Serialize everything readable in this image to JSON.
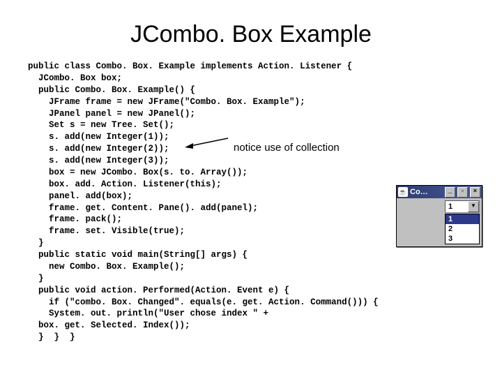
{
  "title": "JCombo. Box Example",
  "code_lines": [
    "public class Combo. Box. Example implements Action. Listener {",
    "  JCombo. Box box;",
    "  public Combo. Box. Example() {",
    "    JFrame frame = new JFrame(\"Combo. Box. Example\");",
    "    JPanel panel = new JPanel();",
    "    Set s = new Tree. Set();",
    "    s. add(new Integer(1));",
    "    s. add(new Integer(2));",
    "    s. add(new Integer(3));",
    "    box = new JCombo. Box(s. to. Array());",
    "    box. add. Action. Listener(this);",
    "    panel. add(box);",
    "    frame. get. Content. Pane(). add(panel);",
    "    frame. pack();",
    "    frame. set. Visible(true);",
    "  }",
    "  public static void main(String[] args) {",
    "    new Combo. Box. Example();",
    "  }",
    "  public void action. Performed(Action. Event e) {",
    "    if (\"combo. Box. Changed\". equals(e. get. Action. Command())) {",
    "    System. out. println(\"User chose index \" +",
    "  box. get. Selected. Index());",
    "  }  }  }"
  ],
  "annotation": "notice use of collection",
  "window": {
    "title": "Co…",
    "buttons": {
      "min": "_",
      "max": "▫",
      "close": "×"
    },
    "selected": "1",
    "drop_glyph": "▼",
    "options": [
      "1",
      "2",
      "3"
    ],
    "selected_index": 0
  },
  "coffee_glyph": "☕"
}
